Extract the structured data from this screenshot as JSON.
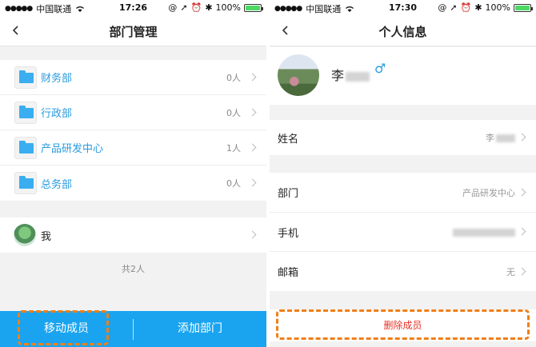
{
  "left": {
    "status": {
      "carrier": "中国联通",
      "time": "17:26",
      "battery": "100%"
    },
    "nav": {
      "title": "部门管理"
    },
    "departments": [
      {
        "name": "财务部",
        "count": "0人"
      },
      {
        "name": "行政部",
        "count": "0人"
      },
      {
        "name": "产品研发中心",
        "count": "1人"
      },
      {
        "name": "总务部",
        "count": "0人"
      }
    ],
    "me": {
      "label": "我"
    },
    "total": "共2人",
    "bottom": {
      "move_label": "移动成员",
      "add_label": "添加部门"
    }
  },
  "right": {
    "status": {
      "carrier": "中国联通",
      "time": "17:30",
      "battery": "100%"
    },
    "nav": {
      "title": "个人信息"
    },
    "profile": {
      "name": "李",
      "gender_icon": "♂"
    },
    "fields": {
      "name": {
        "label": "姓名",
        "value": "李"
      },
      "department": {
        "label": "部门",
        "value": "产品研发中心"
      },
      "phone": {
        "label": "手机",
        "value": ""
      },
      "email": {
        "label": "邮箱",
        "value": "无"
      }
    },
    "delete_label": "删除成员"
  },
  "colors": {
    "accent": "#1aa4f0",
    "link": "#2a9be0",
    "danger": "#e8352b",
    "highlight": "#f07f18",
    "battery": "#4cd964"
  },
  "icons": {
    "back": "chevron-left-icon",
    "chevron": "chevron-right-icon",
    "folder": "folder-icon",
    "gender": "male-icon"
  }
}
